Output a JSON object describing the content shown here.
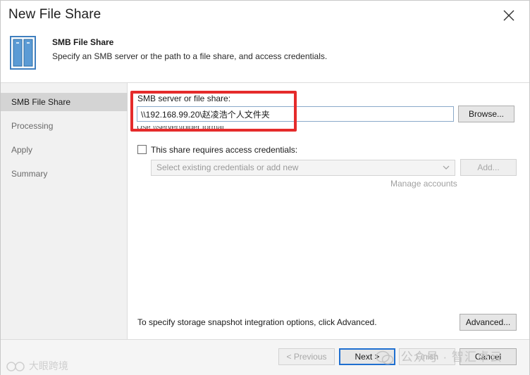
{
  "window": {
    "title": "New File Share",
    "close_icon": "close-icon"
  },
  "header": {
    "icon": "file-share-icon",
    "title": "SMB File Share",
    "description": "Specify an SMB server or the path to a file share, and access credentials."
  },
  "sidebar": {
    "items": [
      {
        "label": "SMB File Share",
        "active": true
      },
      {
        "label": "Processing",
        "active": false
      },
      {
        "label": "Apply",
        "active": false
      },
      {
        "label": "Summary",
        "active": false
      }
    ]
  },
  "form": {
    "server_label": "SMB server or file share:",
    "server_value": "\\\\192.168.99.20\\赵凌浩个人文件夹",
    "browse_label": "Browse...",
    "hint_text": "Use \\\\server\\folder format",
    "credentials_checkbox_label": "This share requires access credentials:",
    "credentials_checked": false,
    "credentials_select_placeholder": "Select existing credentials or add new",
    "add_label": "Add...",
    "manage_accounts_label": "Manage accounts",
    "advanced_hint": "To specify storage snapshot integration options, click Advanced.",
    "advanced_label": "Advanced..."
  },
  "footer": {
    "previous_label": "< Previous",
    "next_label": "Next >",
    "finish_label": "Finish",
    "cancel_label": "Cancel"
  },
  "watermarks": {
    "left_text": "大眼跨境",
    "right_text": "公众号 · 智汇卓云"
  },
  "colors": {
    "highlight": "#e52b2b",
    "input_border": "#8aa9c9",
    "active_nav": "#d4d4d4",
    "primary_button_border": "#1f6fd0"
  }
}
